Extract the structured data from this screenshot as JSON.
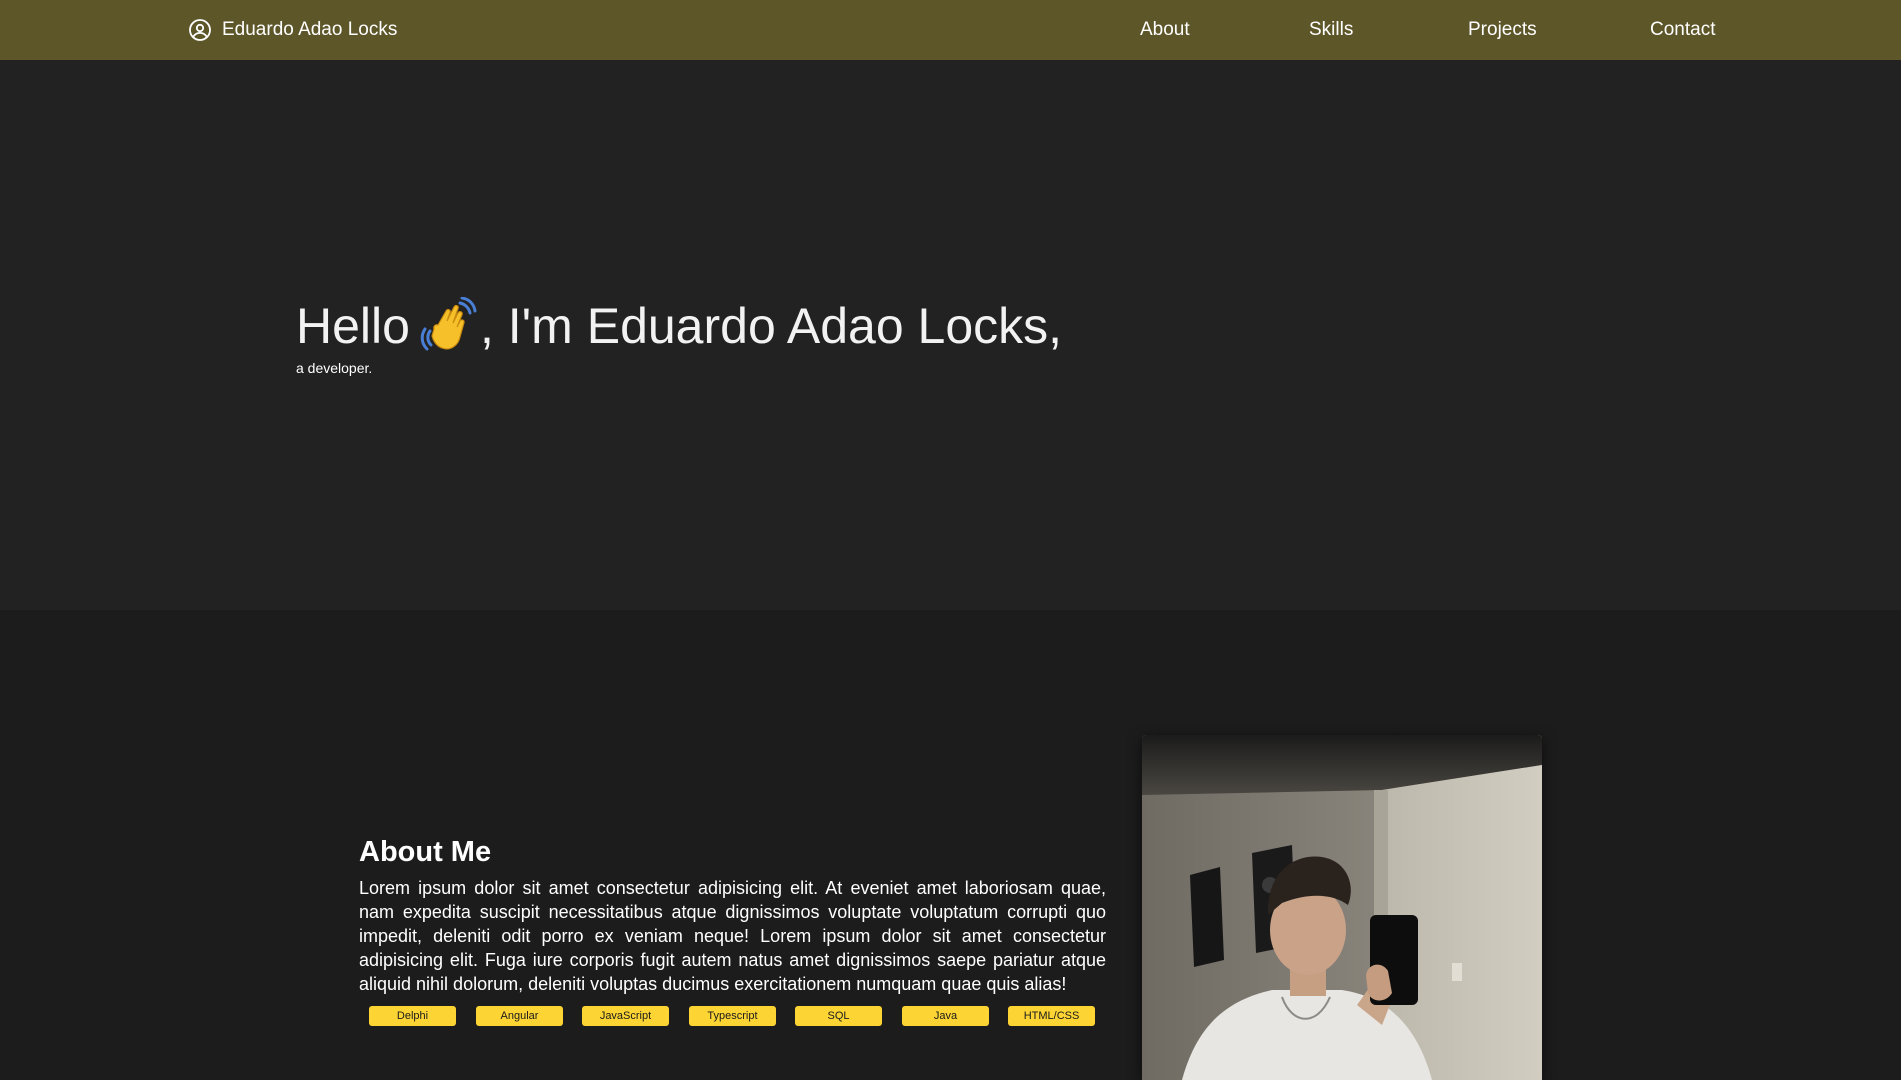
{
  "navbar": {
    "brand_icon": "user-circle-icon",
    "brand_name": "Eduardo Adao Locks",
    "links": [
      {
        "label": "About"
      },
      {
        "label": "Skills"
      },
      {
        "label": "Projects"
      },
      {
        "label": "Contact"
      }
    ],
    "background_color": "#5d5629"
  },
  "hero": {
    "greeting_before": "Hello",
    "wave_icon": "waving-hand-icon",
    "greeting_after": ", I'm Eduardo Adao Locks,",
    "subtitle": "a developer."
  },
  "about": {
    "title": "About Me",
    "text": "Lorem ipsum dolor sit amet consectetur adipisicing elit. At eveniet amet laboriosam quae, nam expedita suscipit necessitatibus atque dignissimos voluptate voluptatum corrupti quo impedit, deleniti odit porro ex veniam neque! Lorem ipsum dolor sit amet consectetur adipisicing elit. Fuga iure corporis fugit autem natus amet dignissimos saepe pariatur atque aliquid nihil dolorum, deleniti voluptas ducimus exercitationem numquam quae quis alias!",
    "skills": [
      "Delphi",
      "Angular",
      "JavaScript",
      "Typescript",
      "SQL",
      "Java",
      "HTML/CSS"
    ],
    "badge_color": "#fcd535",
    "photo": "profile-photo"
  }
}
